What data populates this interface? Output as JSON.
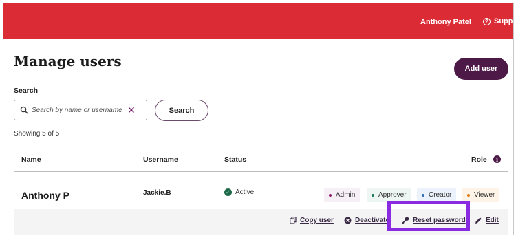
{
  "header": {
    "user_name": "Anthony Patel",
    "support_label": "Supp"
  },
  "page": {
    "title": "Manage users",
    "add_user_label": "Add user"
  },
  "search": {
    "label": "Search",
    "placeholder": "Search by name or username",
    "clear_symbol": "✕",
    "button_label": "Search"
  },
  "results": {
    "showing_text": "Showing 5 of 5"
  },
  "table": {
    "columns": [
      "Name",
      "Username",
      "Status",
      "Role"
    ],
    "rows": [
      {
        "name": "Anthony P",
        "username": "Jackie.B",
        "status": "Active",
        "roles": [
          {
            "label": "Admin",
            "color": "#8b1a6b",
            "bg": "#f7eff6"
          },
          {
            "label": "Approver",
            "color": "#1b7a5a",
            "bg": "#edf6f2"
          },
          {
            "label": "Creator",
            "color": "#2f6fb7",
            "bg": "#ebf2fb"
          },
          {
            "label": "Viewer",
            "color": "#e07b14",
            "bg": "#fdf3e6"
          }
        ],
        "actions": [
          {
            "label": "Copy user",
            "icon": "copy-icon"
          },
          {
            "label": "Deactivate",
            "icon": "deactivate-icon"
          },
          {
            "label": "Reset password",
            "icon": "key-icon"
          },
          {
            "label": "Edit",
            "icon": "pencil-icon"
          }
        ]
      }
    ]
  },
  "colors": {
    "topbar": "#db2b34",
    "primary": "#4d1a48",
    "highlight": "#8a2be2"
  }
}
